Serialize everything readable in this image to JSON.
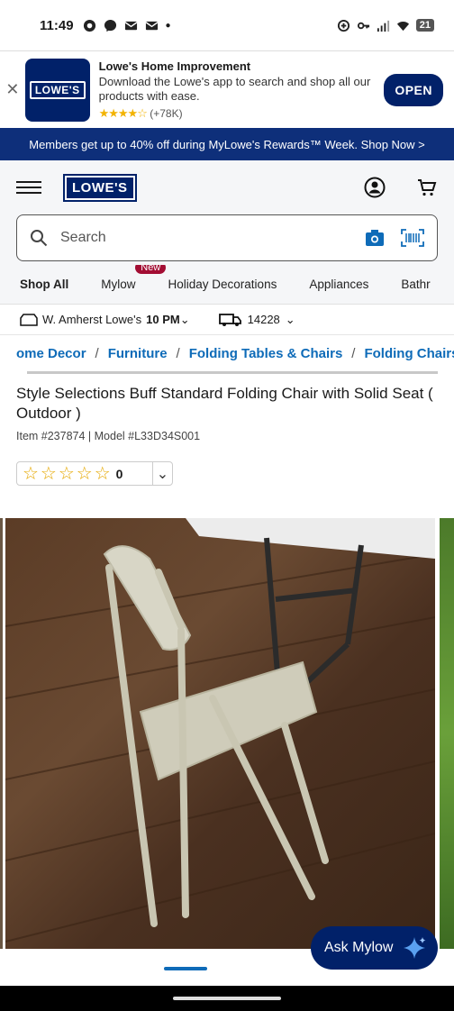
{
  "status_bar": {
    "time": "11:49",
    "battery": "21"
  },
  "app_banner": {
    "name": "Lowe's Home Improvement",
    "description": "Download the Lowe's app to search and shop all our products with ease.",
    "stars": "★★★★☆",
    "rating_count": "(+78K)",
    "logo_text": "LOWE'S",
    "open_label": "OPEN"
  },
  "promo": {
    "text": "Members get up to 40% off during MyLowe's Rewards™ Week. Shop Now >"
  },
  "header": {
    "logo_text": "LOWE'S"
  },
  "search": {
    "placeholder": "Search"
  },
  "nav": {
    "tabs": [
      "Shop All",
      "Mylow",
      "Holiday Decorations",
      "Appliances",
      "Bathr"
    ],
    "new_badge": "New"
  },
  "store": {
    "name": "W. Amherst Lowe's",
    "hours": "10 PM",
    "zip": "14228"
  },
  "breadcrumb": [
    "ome Decor",
    "Furniture",
    "Folding Tables & Chairs",
    "Folding Chairs"
  ],
  "product": {
    "title": "Style Selections Buff Standard Folding Chair with Solid Seat ( Outdoor )",
    "meta": "Item #237874 | Model #L33D34S001",
    "rating_stars": "☆☆☆☆☆",
    "review_count": "0"
  },
  "assistant": {
    "label": "Ask Mylow"
  },
  "colors": {
    "brand_navy": "#012169",
    "link_blue": "#0e6bb8",
    "promo_bg": "#0e2f7a",
    "badge_red": "#a30d33"
  }
}
